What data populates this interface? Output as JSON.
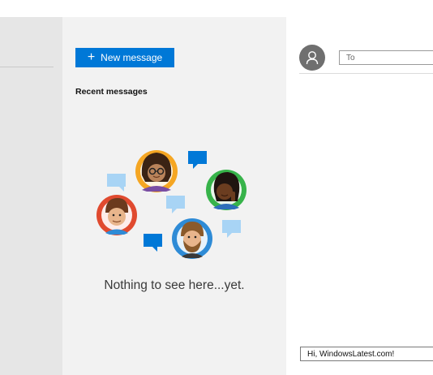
{
  "toolbar": {
    "new_message_label": "New message"
  },
  "conversations": {
    "section_title": "Recent messages",
    "empty_text": "Nothing to see here...yet."
  },
  "compose": {
    "to_placeholder": "To",
    "message_value": "Hi, WindowsLatest.com!"
  },
  "icons": [
    "plus-icon",
    "person-icon",
    "people-chat-illustration"
  ],
  "colors": {
    "accent": "#0078d7",
    "left_pane": "#e6e6e6",
    "middle_pane": "#f2f2f2",
    "avatar": "#6f6f6f"
  }
}
